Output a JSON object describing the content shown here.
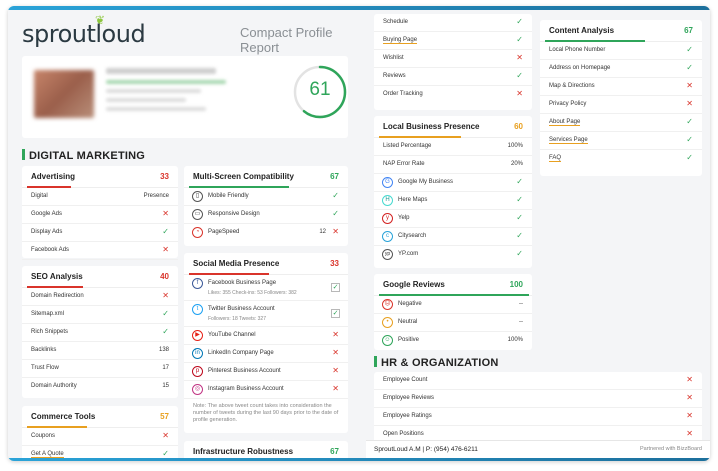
{
  "brand": {
    "logo": "sproutloud",
    "report_title": "Compact Profile Report"
  },
  "profile": {
    "score": "61"
  },
  "colors": {
    "green": "#2fa55a",
    "red": "#d9342b",
    "orange": "#e8a020",
    "blue": "#2aa3d8"
  },
  "sections": {
    "digital_marketing": "DIGITAL MARKETING",
    "hr": "HR & ORGANIZATION"
  },
  "advertising": {
    "title": "Advertising",
    "score": "33",
    "header_left": "Digital",
    "header_right": "Presence",
    "rows": [
      {
        "label": "Google Ads",
        "mark": "✕"
      },
      {
        "label": "Display Ads",
        "mark": "✓"
      },
      {
        "label": "Facebook Ads",
        "mark": "✕"
      }
    ]
  },
  "seo": {
    "title": "SEO Analysis",
    "score": "40",
    "rows": [
      {
        "label": "Domain Redirection",
        "mark": "✕"
      },
      {
        "label": "Sitemap.xml",
        "mark": "✓"
      },
      {
        "label": "Rich Snippets",
        "mark": "✓"
      },
      {
        "label": "Backlinks",
        "value": "138"
      },
      {
        "label": "Trust Flow",
        "value": "17"
      },
      {
        "label": "Domain Authority",
        "value": "15"
      }
    ]
  },
  "commerce": {
    "title": "Commerce Tools",
    "score": "57",
    "rows": [
      {
        "label": "Coupons",
        "mark": "✕"
      },
      {
        "label": "Get A Quote",
        "mark": "✓"
      }
    ]
  },
  "multiscreen": {
    "title": "Multi-Screen Compatibility",
    "score": "67",
    "rows": [
      {
        "label": "Mobile Friendly",
        "mark": "✓"
      },
      {
        "label": "Responsive Design",
        "mark": "✓"
      },
      {
        "label": "PageSpeed",
        "value": "12",
        "mark": "✕"
      }
    ]
  },
  "social": {
    "title": "Social Media Presence",
    "score": "33",
    "fb": {
      "label": "Facebook Business Page",
      "sub": "Likes: 355  Check-ins: 53  Followers: 382"
    },
    "tw": {
      "label": "Twitter Business Account",
      "sub": "Followers: 18  Tweets: 327"
    },
    "rows": [
      {
        "label": "YouTube Channel",
        "mark": "✕"
      },
      {
        "label": "LinkedIn Company Page",
        "mark": "✕"
      },
      {
        "label": "Pinterest Business Account",
        "mark": "✕"
      },
      {
        "label": "Instagram Business Account",
        "mark": "✕"
      }
    ],
    "note": "Note: The above tweet count takes into consideration the number of tweets during the last 90 days prior to the date of profile generation."
  },
  "infra": {
    "title": "Infrastructure Robustness",
    "score": "67"
  },
  "website_top": {
    "rows": [
      {
        "label": "Schedule",
        "mark": "✓"
      },
      {
        "label": "Buying Page",
        "mark": "✓"
      },
      {
        "label": "Wishlist",
        "mark": "✕"
      },
      {
        "label": "Reviews",
        "mark": "✓"
      },
      {
        "label": "Order Tracking",
        "mark": "✕"
      }
    ]
  },
  "local": {
    "title": "Local Business Presence",
    "score": "60",
    "rows": [
      {
        "label": "Listed Percentage",
        "value": "100%"
      },
      {
        "label": "NAP Error Rate",
        "value": "20%"
      }
    ],
    "listings": [
      {
        "label": "Google My Business",
        "icon": "G",
        "mark": "✓"
      },
      {
        "label": "Here Maps",
        "icon": "H",
        "mark": "✓"
      },
      {
        "label": "Yelp",
        "icon": "y",
        "mark": "✓"
      },
      {
        "label": "Citysearch",
        "icon": "c",
        "mark": "✓"
      },
      {
        "label": "YP.com",
        "icon": "yp",
        "mark": "✓"
      }
    ]
  },
  "reviews": {
    "title": "Google Reviews",
    "score": "100",
    "rows": [
      {
        "label": "Negative",
        "value": "--"
      },
      {
        "label": "Neutral",
        "value": "--"
      },
      {
        "label": "Positive",
        "value": "100%"
      }
    ]
  },
  "content": {
    "title": "Content Analysis",
    "score": "67",
    "rows": [
      {
        "label": "Local Phone Number",
        "mark": "✓"
      },
      {
        "label": "Address on Homepage",
        "mark": "✓"
      },
      {
        "label": "Map & Directions",
        "mark": "✕"
      },
      {
        "label": "Privacy Policy",
        "mark": "✕"
      },
      {
        "label": "About Page",
        "mark": "✓"
      },
      {
        "label": "Services Page",
        "mark": "✓"
      },
      {
        "label": "FAQ",
        "mark": "✓"
      }
    ]
  },
  "hr": {
    "rows": [
      {
        "label": "Employee Count",
        "mark": "✕"
      },
      {
        "label": "Employee Reviews",
        "mark": "✕"
      },
      {
        "label": "Employee Ratings",
        "mark": "✕"
      },
      {
        "label": "Open Positions",
        "mark": "✕"
      }
    ]
  },
  "footer": {
    "left": "SproutLoud A.M | P: (954) 476-6211",
    "right": "Partnered with BizzBoard"
  }
}
